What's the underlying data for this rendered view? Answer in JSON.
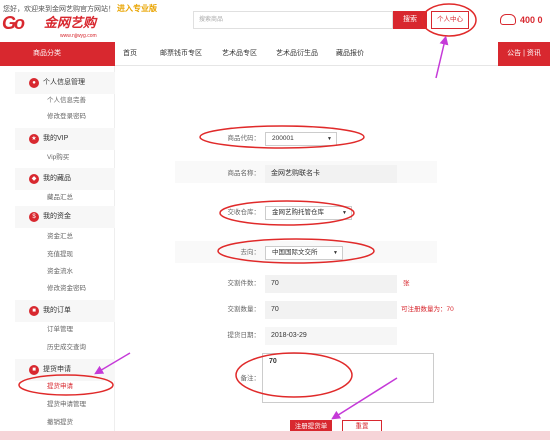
{
  "header": {
    "welcome_text": "您好，欢迎来到金网艺购官方网站！",
    "promo_link": "进入专业版",
    "logo_name": "金网艺购",
    "logo_url": "www.njjwyg.com",
    "search_placeholder": "搜索商品",
    "search_button": "搜索",
    "user_center_button": "个人中心",
    "hotline": "400 0"
  },
  "nav": {
    "category": "商品分类",
    "links": [
      "首页",
      "邮票钱币专区",
      "艺术品专区",
      "艺术品衍生品",
      "藏品报价"
    ],
    "right": "公告 | 资讯"
  },
  "sidebar": {
    "groups": [
      {
        "label": "个人信息管理",
        "icon": "user-icon",
        "items": [
          "个人信息完善",
          "修改登录密码"
        ]
      },
      {
        "label": "我的VIP",
        "icon": "vip-icon",
        "items": [
          "Vip购买"
        ]
      },
      {
        "label": "我的藏品",
        "icon": "collection-icon",
        "items": [
          "藏品汇总"
        ]
      },
      {
        "label": "我的资金",
        "icon": "money-icon",
        "items": [
          "资金汇总",
          "充值提现",
          "资金流水",
          "修改资金密码"
        ]
      },
      {
        "label": "我的订单",
        "icon": "order-icon",
        "items": [
          "订单管理",
          "历史成交查询"
        ]
      },
      {
        "label": "提货申请",
        "icon": "delivery-icon",
        "items": [
          "提货申请",
          "提货申请管理",
          "撤销提货"
        ]
      }
    ]
  },
  "form": {
    "product_code_label": "商品代码：",
    "product_code_value": "200001",
    "product_name_label": "商品名称：",
    "product_name_value": "金网艺购联名卡",
    "warehouse_label": "交收仓库：",
    "warehouse_value": "金网艺购托管仓库",
    "destination_label": "去向：",
    "destination_value": "中国国际文交所",
    "piece_count_label": "交割件数：",
    "piece_count_value": "70",
    "piece_unit": "张",
    "quantity_label": "交割数量：",
    "quantity_value": "70",
    "quantity_note": "可注册数量为：70",
    "date_label": "提货日期：",
    "date_value": "2018-03-29",
    "remark_label": "备注：",
    "remark_value": "70",
    "submit_button": "注册提货单",
    "reset_button": "重置"
  },
  "colors": {
    "brand_red": "#d8282f",
    "promo_yellow": "#e9a400",
    "annotation_red": "#e02a2a",
    "annotation_arrow": "#c53ad8"
  }
}
